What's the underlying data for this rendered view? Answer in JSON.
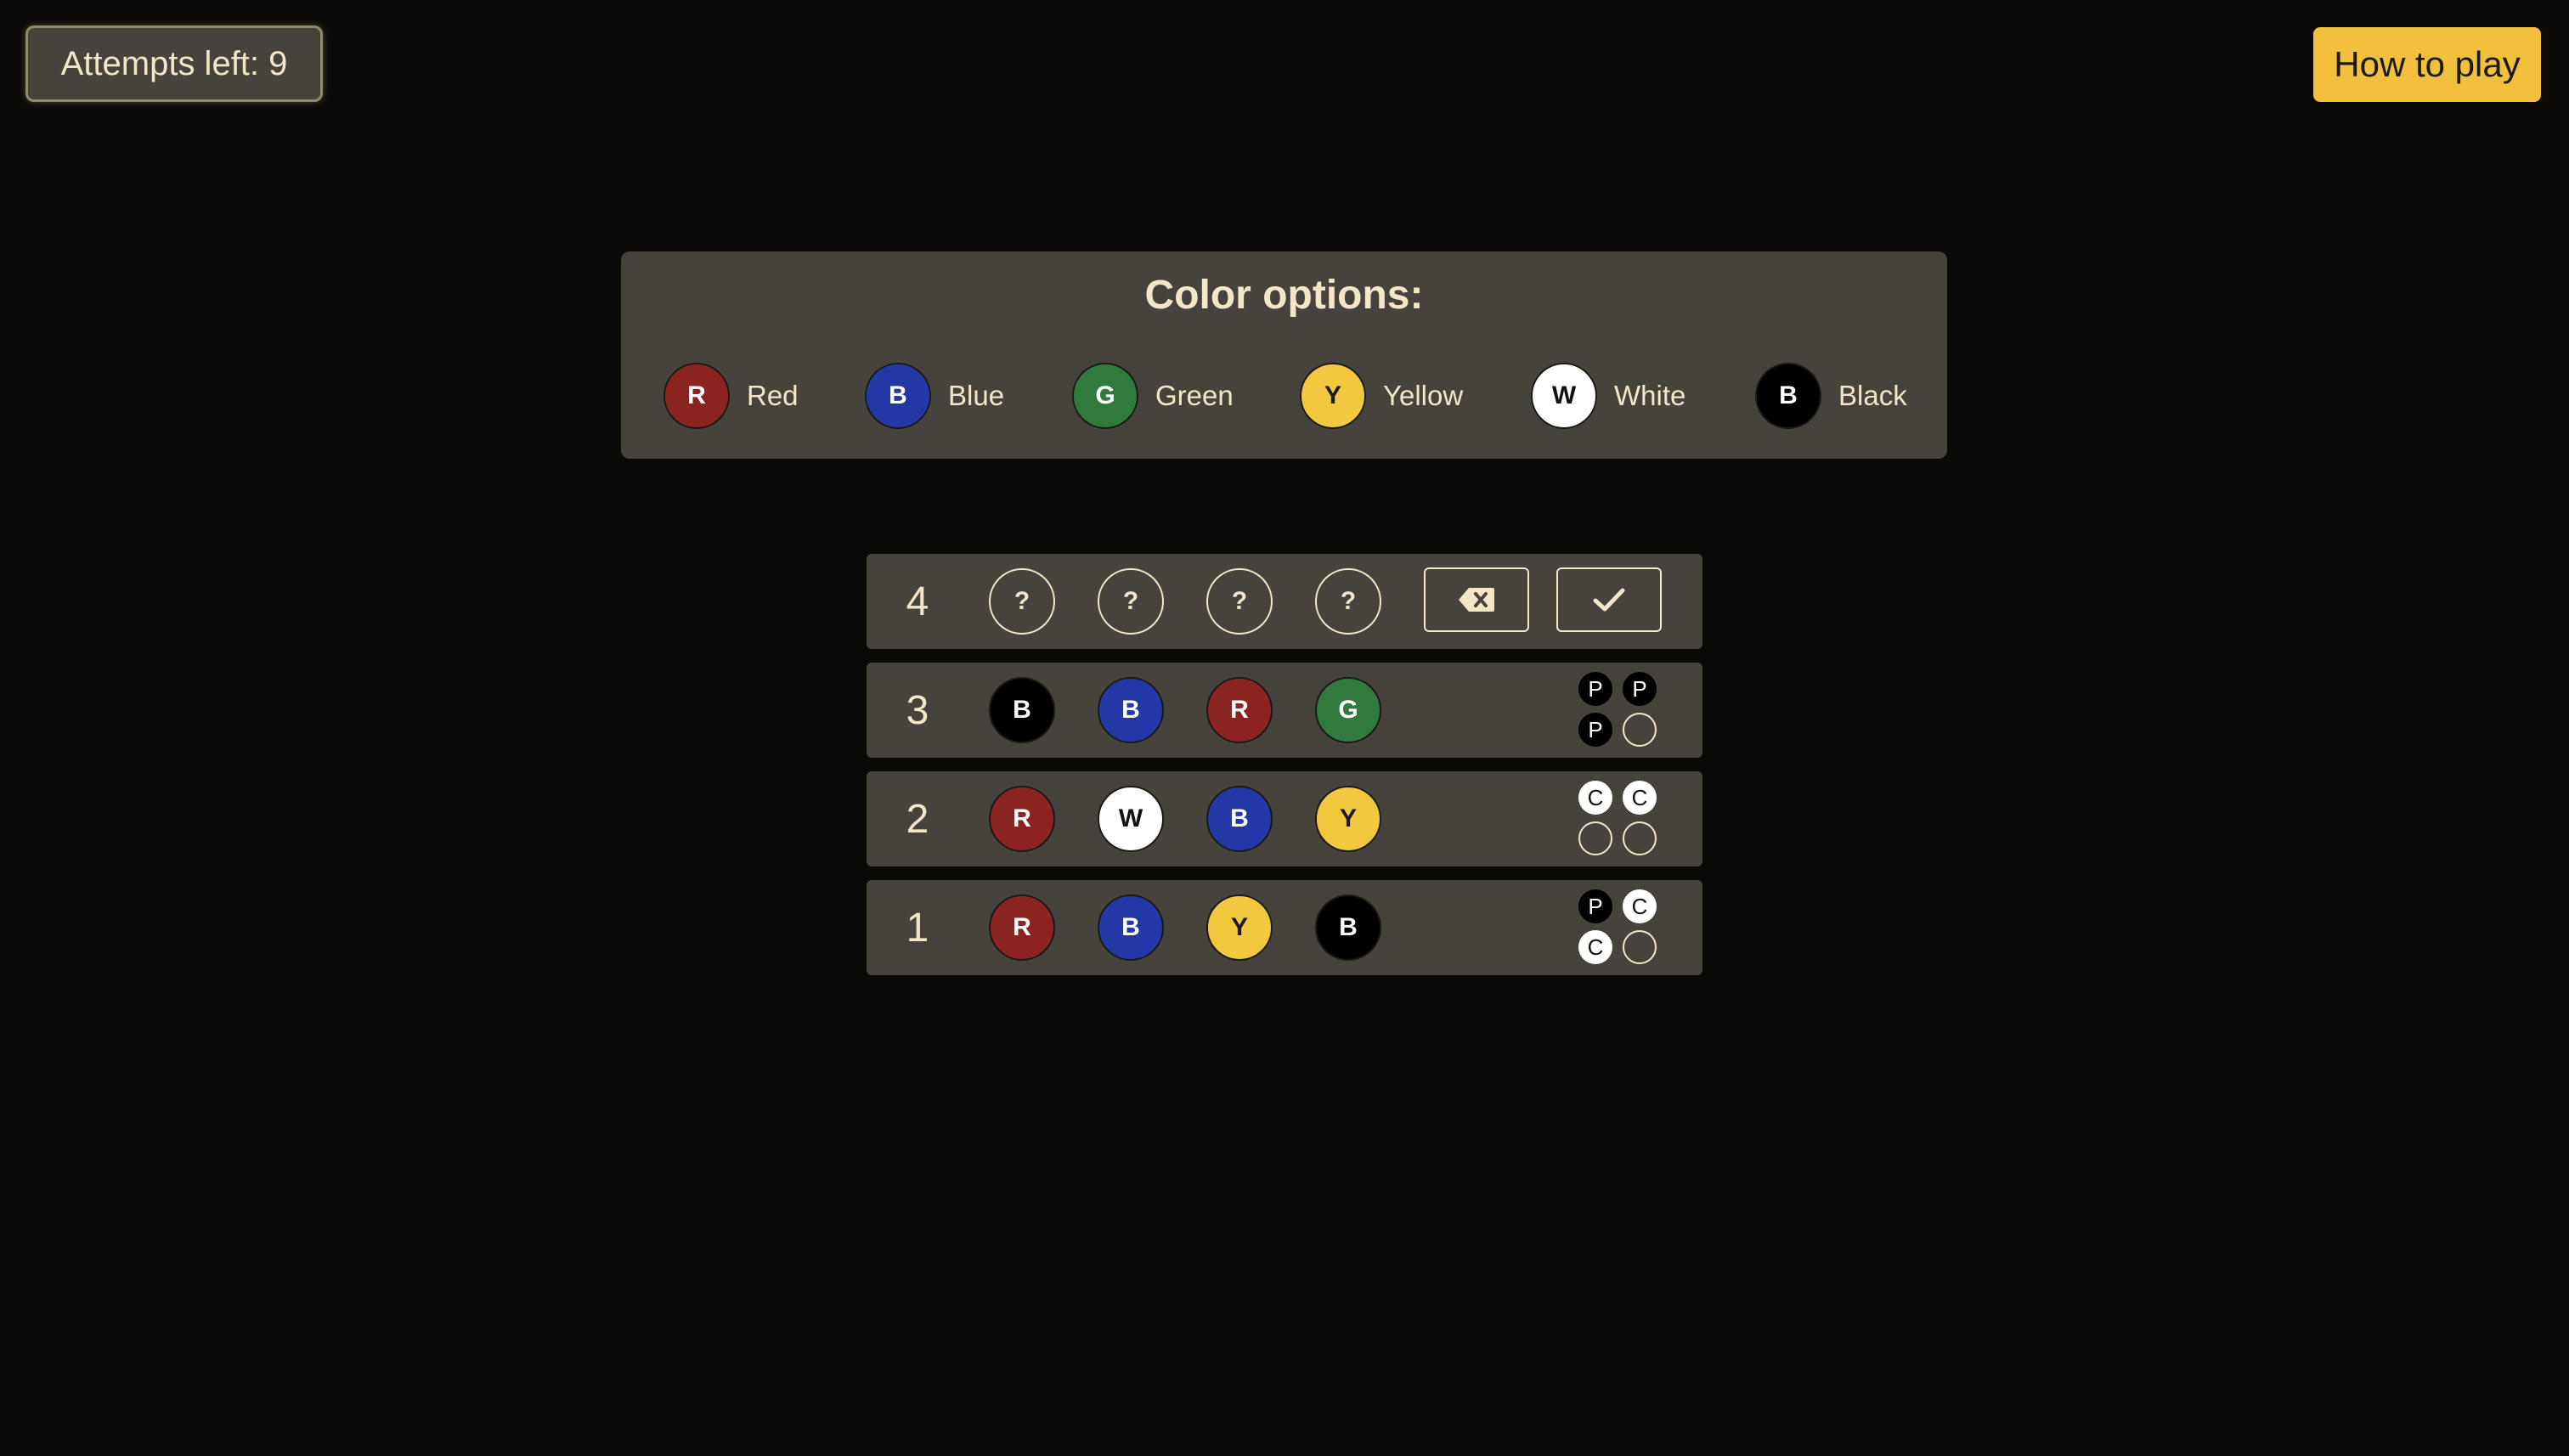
{
  "header": {
    "attempts_label": "Attempts left: 9",
    "how_to_play_label": "How to play"
  },
  "color_options": {
    "title": "Color options:",
    "items": [
      {
        "letter": "R",
        "label": "Red",
        "color": "#8b2420"
      },
      {
        "letter": "B",
        "label": "Blue",
        "color": "#2338a5"
      },
      {
        "letter": "G",
        "label": "Green",
        "color": "#2f7a3c"
      },
      {
        "letter": "Y",
        "label": "Yellow",
        "color": "#f2c83e"
      },
      {
        "letter": "W",
        "label": "White",
        "color": "#ffffff"
      },
      {
        "letter": "B",
        "label": "Black",
        "color": "#000000"
      }
    ]
  },
  "board": {
    "current": {
      "number": "4",
      "slots": [
        "?",
        "?",
        "?",
        "?"
      ],
      "delete_icon": "backspace-icon",
      "submit_icon": "checkmark-icon"
    },
    "history": [
      {
        "number": "3",
        "pegs": [
          {
            "letter": "B",
            "color": "black"
          },
          {
            "letter": "B",
            "color": "blue"
          },
          {
            "letter": "R",
            "color": "red"
          },
          {
            "letter": "G",
            "color": "green"
          }
        ],
        "feedback": [
          {
            "text": "P",
            "kind": "black"
          },
          {
            "text": "P",
            "kind": "black"
          },
          {
            "text": "P",
            "kind": "black"
          },
          {
            "text": "",
            "kind": "empty"
          }
        ]
      },
      {
        "number": "2",
        "pegs": [
          {
            "letter": "R",
            "color": "red"
          },
          {
            "letter": "W",
            "color": "white"
          },
          {
            "letter": "B",
            "color": "blue"
          },
          {
            "letter": "Y",
            "color": "yellow"
          }
        ],
        "feedback": [
          {
            "text": "C",
            "kind": "white"
          },
          {
            "text": "C",
            "kind": "white"
          },
          {
            "text": "",
            "kind": "empty"
          },
          {
            "text": "",
            "kind": "empty"
          }
        ]
      },
      {
        "number": "1",
        "pegs": [
          {
            "letter": "R",
            "color": "red"
          },
          {
            "letter": "B",
            "color": "blue"
          },
          {
            "letter": "Y",
            "color": "yellow"
          },
          {
            "letter": "B",
            "color": "black"
          }
        ],
        "feedback": [
          {
            "text": "P",
            "kind": "black"
          },
          {
            "text": "C",
            "kind": "white"
          },
          {
            "text": "C",
            "kind": "white"
          },
          {
            "text": "",
            "kind": "empty"
          }
        ]
      }
    ]
  }
}
